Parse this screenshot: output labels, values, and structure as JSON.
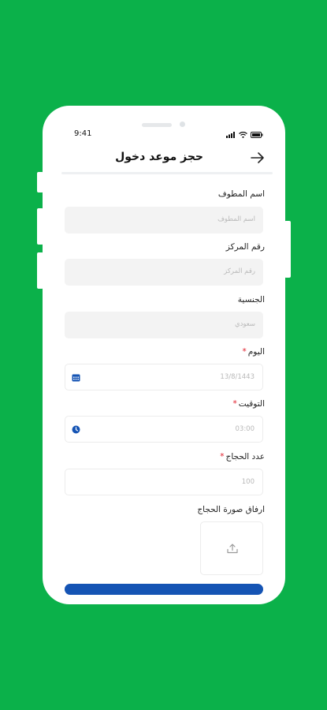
{
  "status_bar": {
    "time": "9:41"
  },
  "header": {
    "title": "حجز موعد دخول"
  },
  "form": {
    "employee_name": {
      "label": "اسم المطوف",
      "placeholder": "اسم المطوف"
    },
    "center_number": {
      "label": "رقم المركز",
      "placeholder": "رقم المركز"
    },
    "nationality": {
      "label": "الجنسية",
      "value": "سعودي"
    },
    "day": {
      "label": "اليوم",
      "required_mark": "*",
      "value": "13/8/1443"
    },
    "time": {
      "label": "التوقيت",
      "required_mark": "*",
      "value": "03:00"
    },
    "pilgrims_count": {
      "label": "عدد الحجاج",
      "required_mark": "*",
      "value": "100"
    },
    "attach_photo": {
      "label": "ارفاق صورة الحجاج"
    }
  },
  "colors": {
    "background": "#0bb14a",
    "primary_button": "#1554b4",
    "required": "#e11d2a",
    "calendar_icon": "#1554b4"
  },
  "icons": [
    "back-arrow-icon",
    "calendar-icon",
    "clock-icon",
    "upload-icon",
    "signal-icon",
    "wifi-icon",
    "battery-icon"
  ]
}
